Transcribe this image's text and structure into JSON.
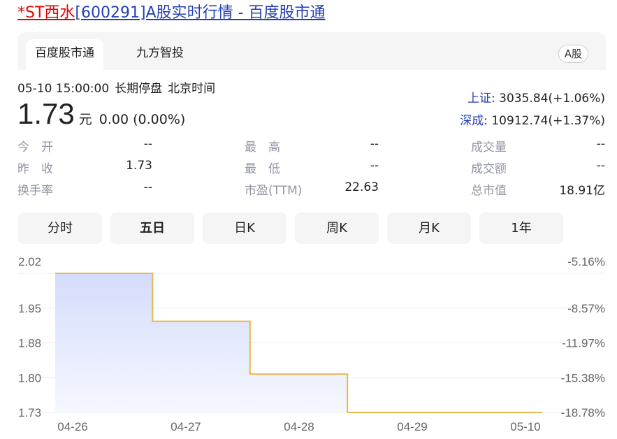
{
  "title": {
    "name": "*ST西水",
    "rest": "[600291]A股实时行情 - 百度股市通"
  },
  "source_tabs": [
    "百度股市通",
    "九方智投"
  ],
  "market_badge": "A股",
  "status": {
    "time": "05-10 15:00:00",
    "state": "长期停盘",
    "tz": "北京时间"
  },
  "quote": {
    "price": "1.73",
    "unit": "元",
    "change": "0.00 (0.00%)"
  },
  "indices": [
    {
      "name": "上证",
      "value": ": 3035.84(+1.06%)"
    },
    {
      "name": "深成",
      "value": ": 10912.74(+1.37%)"
    }
  ],
  "stats": {
    "open": {
      "label": "今　开",
      "value": "--"
    },
    "prev_close": {
      "label": "昨　收",
      "value": "1.73"
    },
    "turnover_rate": {
      "label": "换手率",
      "value": "--"
    },
    "high": {
      "label": "最　高",
      "value": "--"
    },
    "low": {
      "label": "最　低",
      "value": "--"
    },
    "pe_ttm": {
      "label": "市盈(TTM)",
      "value": "22.63"
    },
    "volume": {
      "label": "成交量",
      "value": "--"
    },
    "amount": {
      "label": "成交额",
      "value": "--"
    },
    "market_cap": {
      "label": "总市值",
      "value": "18.91亿"
    }
  },
  "period_tabs": [
    "分时",
    "五日",
    "日K",
    "周K",
    "月K",
    "1年"
  ],
  "active_period": "五日",
  "colors": {
    "line": "#e8b84d",
    "fill_top": "#d4dcfb",
    "fill_bottom": "#f6f8ff",
    "grid": "#ececec",
    "axis_text": "#666666",
    "link_blue": "#2440b3",
    "name_red": "#e10601"
  },
  "chart_data": {
    "type": "area",
    "x_labels": [
      "04-26",
      "04-27",
      "04-28",
      "04-29",
      "05-10"
    ],
    "y_ticks": [
      "2.02",
      "1.95",
      "1.88",
      "1.80",
      "1.73"
    ],
    "y_pct_ticks": [
      "-5.16%",
      "-8.57%",
      "-11.97%",
      "-15.38%",
      "-18.78%"
    ],
    "ylim": [
      1.73,
      2.02
    ],
    "series": [
      {
        "values": [
          2.02,
          1.92,
          1.81,
          1.73,
          1.73
        ]
      }
    ]
  }
}
